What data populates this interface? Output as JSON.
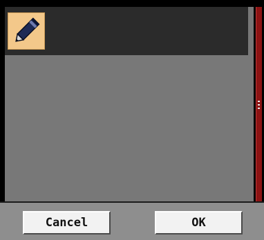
{
  "list": {
    "items": [
      {
        "icon": "pen-icon",
        "selected": true
      }
    ]
  },
  "buttons": {
    "cancel_label": "Cancel",
    "ok_label": "OK"
  },
  "colors": {
    "content_bg": "#787878",
    "row_bg": "#2b2b2b",
    "icon_tile_bg": "#f3c88a",
    "scrollbar": "#8c1414",
    "bottom_bar": "#8e8e8e",
    "button_bg": "#f2f2f2"
  }
}
